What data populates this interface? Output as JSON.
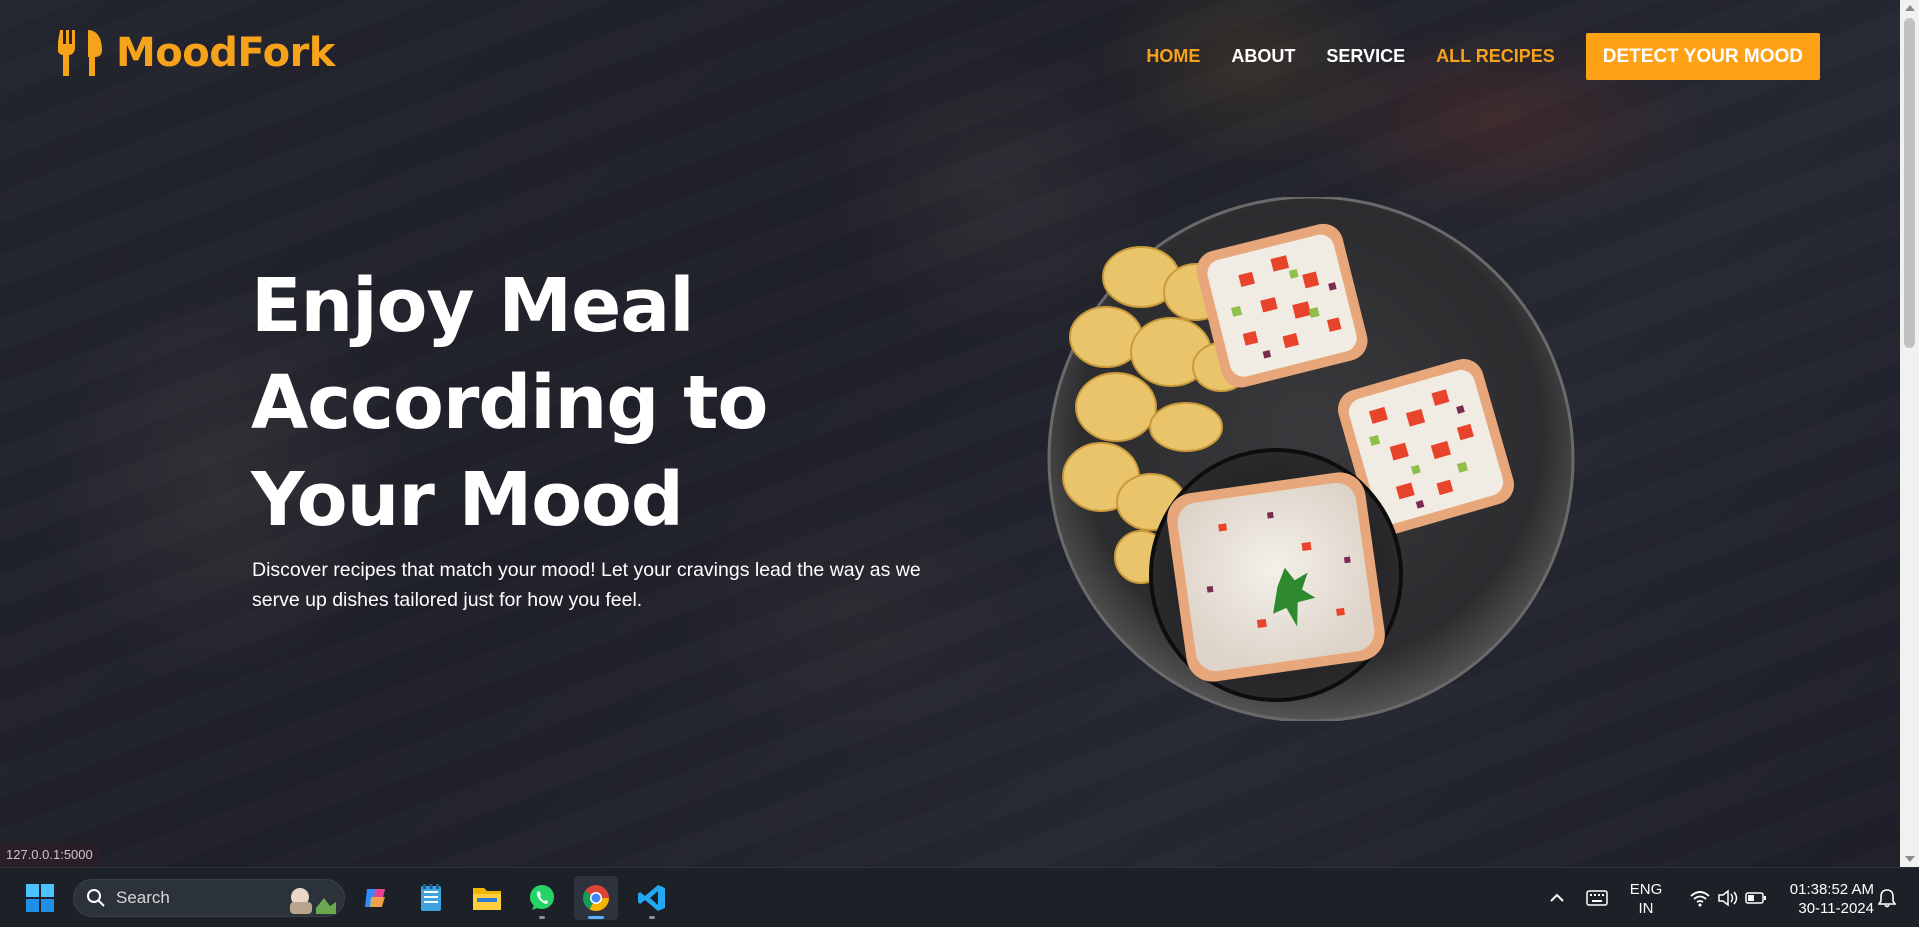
{
  "brand": {
    "name": "MoodFork",
    "accent": "#f7a21b",
    "icon": "fork-knife-icon"
  },
  "nav": {
    "items": [
      {
        "label": "HOME",
        "color": "orange"
      },
      {
        "label": "ABOUT",
        "color": "white"
      },
      {
        "label": "SERVICE",
        "color": "white"
      },
      {
        "label": "ALL RECIPES",
        "color": "orange"
      }
    ],
    "cta_label": "DETECT YOUR MOOD",
    "cta_color": "#fea116"
  },
  "hero": {
    "title_lines": [
      "Enjoy Meal",
      "According to",
      "Your Mood"
    ],
    "subtitle": "Discover recipes that match your mood! Let your cravings lead the way as we serve up dishes tailored just for how you feel.",
    "image": "plate-of-toast-and-chips"
  },
  "status_url": "127.0.0.1:5000",
  "taskbar": {
    "search_label": "Search",
    "apps": [
      "start-icon",
      "copilot-icon",
      "notepad-icon",
      "file-explorer-icon",
      "whatsapp-icon",
      "chrome-icon",
      "vscode-icon"
    ],
    "active_app": "chrome-icon",
    "language_line1": "ENG",
    "language_line2": "IN",
    "time": "01:38:52 AM",
    "date": "30-11-2024"
  }
}
